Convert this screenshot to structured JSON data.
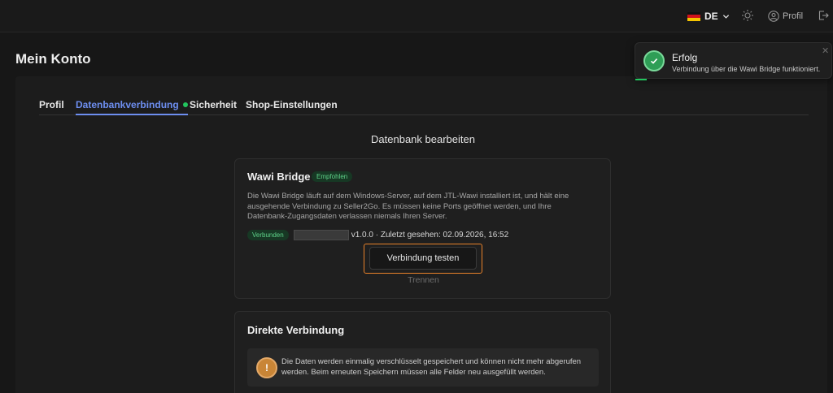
{
  "header": {
    "language": "DE",
    "profile_label": "Profil",
    "icons": [
      "flag-de-icon",
      "chevron-down-icon",
      "sun-icon",
      "user-icon",
      "logout-icon"
    ]
  },
  "page": {
    "title": "Mein Konto"
  },
  "tabs": [
    {
      "label": "Profil",
      "active": false
    },
    {
      "label": "Datenbankverbindung",
      "active": true,
      "status": "connected"
    },
    {
      "label": "Sicherheit",
      "active": false
    },
    {
      "label": "Shop-Einstellungen",
      "active": false
    }
  ],
  "section": {
    "title": "Datenbank bearbeiten"
  },
  "wawi_bridge": {
    "title": "Wawi Bridge",
    "badge": "Empfohlen",
    "description": "Die Wawi Bridge läuft auf dem Windows-Server, auf dem JTL-Wawi installiert ist, und hält eine ausgehende Verbindung zu Seller2Go. Es müssen keine Ports geöffnet werden, und Ihre Datenbank-Zugangsdaten verlassen niemals Ihren Server.",
    "status_badge": "Verbunden",
    "version_info": "v1.0.0 · Zuletzt gesehen: 02.09.2026, 16:52",
    "test_button": "Verbindung testen",
    "disconnect_button": "Trennen"
  },
  "direct_connection": {
    "title": "Direkte Verbindung",
    "warning_icon": "!",
    "warning_text": "Die Daten werden einmalig verschlüsselt gespeichert und können nicht mehr abgerufen werden. Beim erneuten Speichern müssen alle Felder neu ausgefüllt werden."
  },
  "toast": {
    "title": "Erfolg",
    "message": "Verbindung über die Wawi Bridge funktioniert.",
    "close": "✕"
  },
  "colors": {
    "accent": "#6d8ef0",
    "success": "#22c55e",
    "warning": "#c98536",
    "highlight": "#e8822a"
  }
}
